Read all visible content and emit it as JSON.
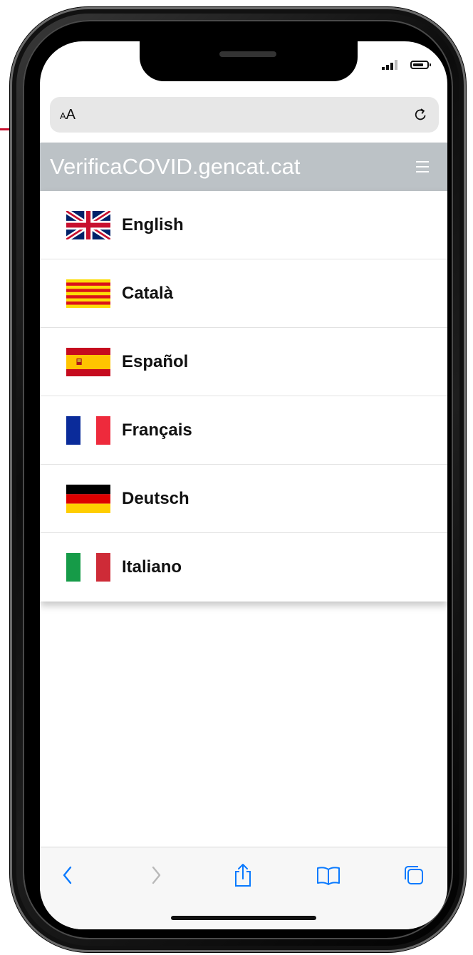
{
  "browser": {
    "text_size_label": "AA",
    "reload_icon": "reload-icon"
  },
  "site": {
    "title": "VerificaCOVID.gencat.cat",
    "menu_icon": "hamburger-menu-icon"
  },
  "languages": [
    {
      "label": "English",
      "flag": "uk-flag-icon"
    },
    {
      "label": "Català",
      "flag": "catalonia-flag-icon"
    },
    {
      "label": "Español",
      "flag": "spain-flag-icon"
    },
    {
      "label": "Français",
      "flag": "france-flag-icon"
    },
    {
      "label": "Deutsch",
      "flag": "germany-flag-icon"
    },
    {
      "label": "Italiano",
      "flag": "italy-flag-icon"
    }
  ],
  "toolbar": {
    "back_icon": "chevron-left-icon",
    "forward_icon": "chevron-right-icon",
    "share_icon": "share-icon",
    "bookmarks_icon": "book-icon",
    "tabs_icon": "tabs-icon"
  },
  "colors": {
    "header_bg": "#bcc2c6",
    "ios_blue": "#0a7aff"
  }
}
